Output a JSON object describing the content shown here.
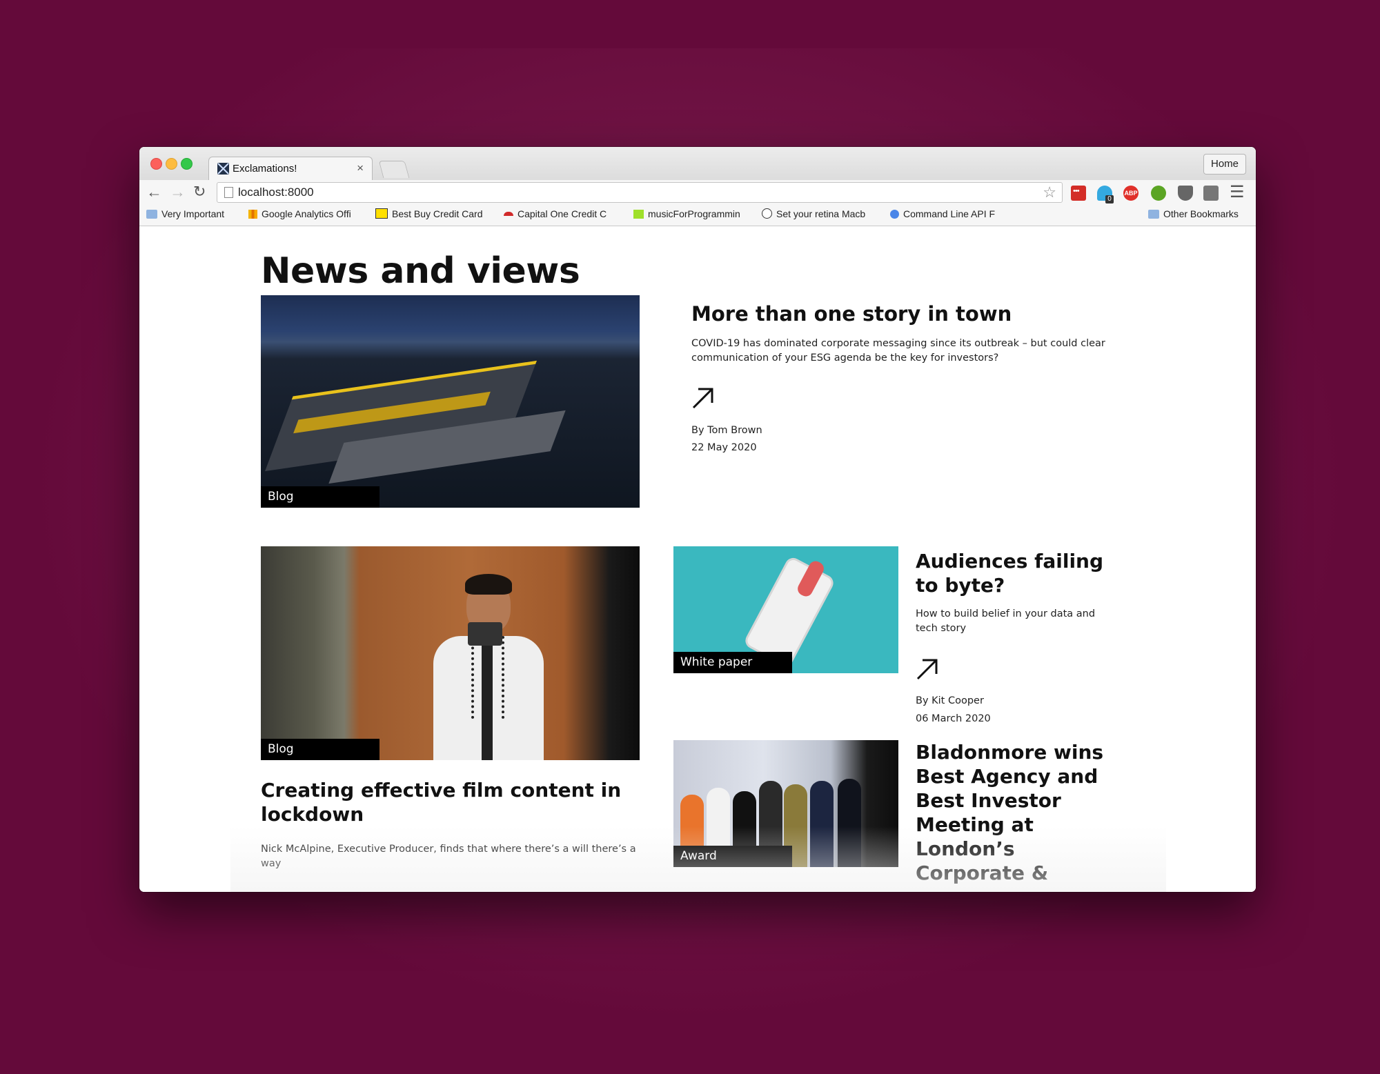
{
  "browser": {
    "tab_title": "Exclamations!",
    "tab_close": "×",
    "home_label": "Home",
    "url": "localhost:8000",
    "bookmarks": [
      {
        "label": "Very Important",
        "icon": "folder-icon"
      },
      {
        "label": "Google Analytics Offi",
        "icon": "analytics-icon"
      },
      {
        "label": "Best Buy Credit Card",
        "icon": "bestbuy-icon"
      },
      {
        "label": "Capital One Credit C",
        "icon": "capitalone-icon"
      },
      {
        "label": "musicForProgrammin",
        "icon": "music-icon"
      },
      {
        "label": "Set your retina Macb",
        "icon": "reddit-icon"
      },
      {
        "label": "Command Line API F",
        "icon": "gear-icon"
      }
    ],
    "other_bookmarks": "Other Bookmarks",
    "ghostery_count": "0",
    "abp_label": "ABP"
  },
  "page": {
    "title": "News and views",
    "articles": [
      {
        "tag": "Blog",
        "title": "More than one story in town",
        "description": "COVID-19 has dominated corporate messaging since its outbreak – but could clear communication of your ESG agenda be the key for investors?",
        "author": "By Tom Brown",
        "date": "22 May 2020"
      },
      {
        "tag": "Blog",
        "title": "Creating effective film content in lockdown",
        "description": "Nick McAlpine, Executive Producer, finds that where there’s a will there’s a way"
      },
      {
        "tag": "White paper",
        "title": "Audiences failing to byte?",
        "description": "How to build belief in your data and tech story",
        "author": "By Kit Cooper",
        "date": "06 March 2020"
      },
      {
        "tag": "Award",
        "title": "Bladonmore wins Best Agency and Best Investor Meeting at London’s Corporate &"
      }
    ]
  },
  "colors": {
    "background": "#640a3a",
    "tag_bg": "#000000",
    "teal": "#3ab8bf"
  }
}
